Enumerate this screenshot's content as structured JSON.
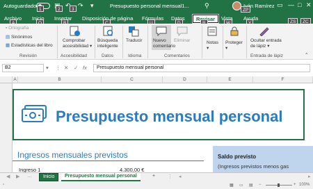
{
  "titlebar": {
    "autosave_label": "Autoguardado",
    "title": "Presupuesto personal mensual1...",
    "user": "Iván Ramírez"
  },
  "keytips": {
    "autosave": "1",
    "undo": "2",
    "redo": "3",
    "user": "ZP",
    "file": "A",
    "home": "O",
    "insert": "B",
    "layout": "C",
    "formulas": "U",
    "data": "D",
    "review": "R",
    "view": "W",
    "help": "Y",
    "right1": "ZS",
    "right2": "ZC"
  },
  "tabs": [
    "Archivo",
    "Inicio",
    "Insertar",
    "Disposición de página",
    "Fórmulas",
    "Datos",
    "Revisar",
    "Vista",
    "Ayuda"
  ],
  "ribbon": {
    "revision": {
      "items": [
        "Ortografía",
        "Sinónimos",
        "Estadísticas del libro"
      ],
      "group": "Revisión"
    },
    "accesibilidad": {
      "button": [
        "Comprobar",
        "accesibilidad"
      ],
      "group": "Accesibilidad"
    },
    "datos": {
      "button": [
        "Búsqueda",
        "inteligente"
      ],
      "group": "Datos"
    },
    "idioma": {
      "button": "Traducir",
      "group": "Idioma"
    },
    "comentarios": {
      "new": [
        "Nuevo",
        "comentario"
      ],
      "delete": "Eliminar",
      "group": "Comentarios"
    },
    "notas": {
      "button": "Notas"
    },
    "proteger": {
      "button": "Proteger"
    },
    "entrada": {
      "button": [
        "Ocultar entrada",
        "de lápiz"
      ],
      "group": "Entrada de lápiz"
    }
  },
  "formula_bar": {
    "namebox": "B2",
    "fx": "fx",
    "content": "Presupuesto mensual personal"
  },
  "columns": [
    "A",
    "B",
    "C",
    "D",
    "E",
    "F"
  ],
  "sheet": {
    "title": "Presupuesto mensual personal",
    "income_header": "Ingresos mensuales previstos",
    "income_row_label": "Ingreso 1",
    "income_row_value": "4.300,00 €",
    "saldo_title": "Saldo previsto",
    "saldo_sub": "(Ingresos previstos menos gas"
  },
  "sheet_tabs": {
    "first": "Inicio",
    "active": "Presupuesto mensual personal",
    "add": "+"
  },
  "status": {
    "zoom": "100%"
  },
  "colors": {
    "excel_green": "#217346",
    "title_blue": "#2b7bc0",
    "saldo_fill": "#bfd5ee"
  }
}
